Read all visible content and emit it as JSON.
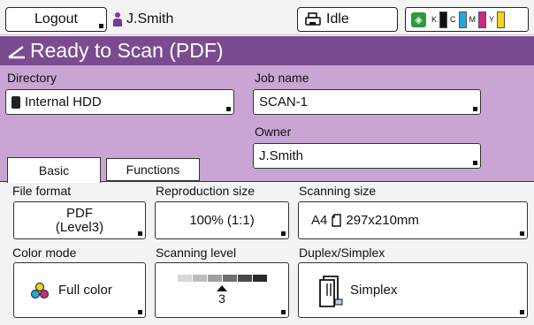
{
  "topbar": {
    "logout_label": "Logout",
    "user_name": "J.Smith",
    "status_label": "Idle",
    "toner": {
      "eco_icon": "leaf-icon",
      "colors": [
        {
          "label": "K",
          "color": "#111111"
        },
        {
          "label": "C",
          "color": "#22a6dd"
        },
        {
          "label": "M",
          "color": "#d0287e"
        },
        {
          "label": "Y",
          "color": "#f2d21c"
        }
      ]
    }
  },
  "title": {
    "text": "Ready to Scan (PDF)",
    "icon": "scan-edge-icon",
    "bar_color": "#7a4b8e"
  },
  "form": {
    "directory_label": "Directory",
    "directory_value": "Internal HDD",
    "job_name_label": "Job name",
    "job_name_value": "SCAN-1",
    "owner_label": "Owner",
    "owner_value": "J.Smith",
    "panel_color": "#c9a5d4"
  },
  "tabs": [
    {
      "label": "Basic",
      "active": true
    },
    {
      "label": "Functions",
      "active": false
    }
  ],
  "settings": {
    "file_format_label": "File format",
    "file_format_line1": "PDF",
    "file_format_line2": "(Level3)",
    "reproduction_size_label": "Reproduction size",
    "reproduction_size_value": "100% (1:1)",
    "scanning_size_label": "Scanning size",
    "scanning_size_paper": "A4",
    "scanning_size_dims": "297x210mm",
    "color_mode_label": "Color mode",
    "color_mode_value": "Full color",
    "scanning_level_label": "Scanning level",
    "scanning_level_value": "3",
    "scanning_level_selected_index": 3,
    "scanning_level_shades": [
      "#d7d7d7",
      "#bdbdbd",
      "#a0a0a0",
      "#6f6f6f",
      "#4a4a4a",
      "#2a2a2a"
    ],
    "duplex_label": "Duplex/Simplex",
    "duplex_value": "Simplex"
  }
}
